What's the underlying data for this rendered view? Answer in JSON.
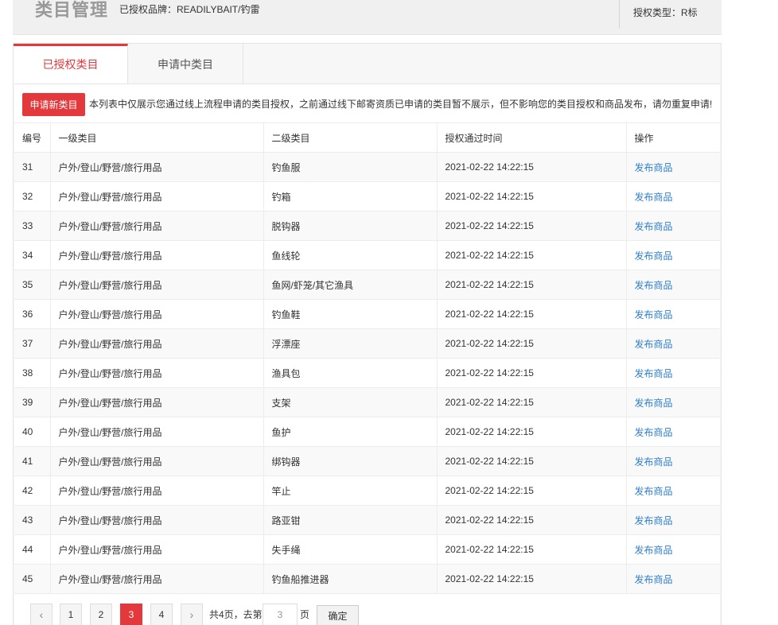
{
  "header": {
    "title": "类目管理",
    "brand": "已授权品牌：READILYBAIT/钓雷",
    "auth_type": "授权类型：R标"
  },
  "tabs": [
    {
      "label": "已授权类目",
      "active": true
    },
    {
      "label": "申请中类目",
      "active": false
    }
  ],
  "notice": {
    "apply_button": "申请新类目",
    "text": "本列表中仅展示您通过线上流程申请的类目授权，之前通过线下邮寄资质已申请的类目暂不展示，但不影响您的类目授权和商品发布，请勿重复申请!"
  },
  "table": {
    "columns": [
      "编号",
      "一级类目",
      "二级类目",
      "授权通过时间",
      "操作"
    ],
    "rows": [
      {
        "id": "31",
        "level1": "户外/登山/野营/旅行用品",
        "level2": "钓鱼服",
        "time": "2021-02-22 14:22:15",
        "action": "发布商品"
      },
      {
        "id": "32",
        "level1": "户外/登山/野营/旅行用品",
        "level2": "钓箱",
        "time": "2021-02-22 14:22:15",
        "action": "发布商品"
      },
      {
        "id": "33",
        "level1": "户外/登山/野营/旅行用品",
        "level2": "脱钩器",
        "time": "2021-02-22 14:22:15",
        "action": "发布商品"
      },
      {
        "id": "34",
        "level1": "户外/登山/野营/旅行用品",
        "level2": "鱼线轮",
        "time": "2021-02-22 14:22:15",
        "action": "发布商品"
      },
      {
        "id": "35",
        "level1": "户外/登山/野营/旅行用品",
        "level2": "鱼网/虾笼/其它渔具",
        "time": "2021-02-22 14:22:15",
        "action": "发布商品"
      },
      {
        "id": "36",
        "level1": "户外/登山/野营/旅行用品",
        "level2": "钓鱼鞋",
        "time": "2021-02-22 14:22:15",
        "action": "发布商品"
      },
      {
        "id": "37",
        "level1": "户外/登山/野营/旅行用品",
        "level2": "浮漂座",
        "time": "2021-02-22 14:22:15",
        "action": "发布商品"
      },
      {
        "id": "38",
        "level1": "户外/登山/野营/旅行用品",
        "level2": "渔具包",
        "time": "2021-02-22 14:22:15",
        "action": "发布商品"
      },
      {
        "id": "39",
        "level1": "户外/登山/野营/旅行用品",
        "level2": "支架",
        "time": "2021-02-22 14:22:15",
        "action": "发布商品"
      },
      {
        "id": "40",
        "level1": "户外/登山/野营/旅行用品",
        "level2": "鱼护",
        "time": "2021-02-22 14:22:15",
        "action": "发布商品"
      },
      {
        "id": "41",
        "level1": "户外/登山/野营/旅行用品",
        "level2": "绑钩器",
        "time": "2021-02-22 14:22:15",
        "action": "发布商品"
      },
      {
        "id": "42",
        "level1": "户外/登山/野营/旅行用品",
        "level2": "竿止",
        "time": "2021-02-22 14:22:15",
        "action": "发布商品"
      },
      {
        "id": "43",
        "level1": "户外/登山/野营/旅行用品",
        "level2": "路亚钳",
        "time": "2021-02-22 14:22:15",
        "action": "发布商品"
      },
      {
        "id": "44",
        "level1": "户外/登山/野营/旅行用品",
        "level2": "失手绳",
        "time": "2021-02-22 14:22:15",
        "action": "发布商品"
      },
      {
        "id": "45",
        "level1": "户外/登山/野营/旅行用品",
        "level2": "钓鱼船推进器",
        "time": "2021-02-22 14:22:15",
        "action": "发布商品"
      }
    ]
  },
  "pagination": {
    "prev_icon": "chevron-left-icon",
    "next_icon": "chevron-right-icon",
    "pages": [
      "1",
      "2",
      "3",
      "4"
    ],
    "current": "3",
    "total_text": "共4页，去第",
    "input_value": "3",
    "page_label": "页",
    "confirm_label": "确定"
  },
  "colors": {
    "accent": "#e4393c",
    "link": "#2d7fd1"
  }
}
